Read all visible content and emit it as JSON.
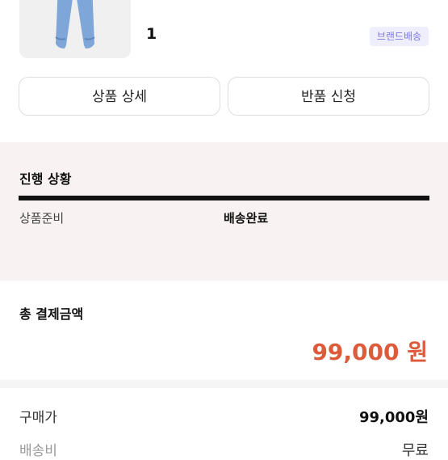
{
  "product": {
    "quantity": "1",
    "badge": "브랜드배송"
  },
  "actions": {
    "detail_label": "상품 상세",
    "return_label": "반품 신청"
  },
  "progress": {
    "title": "진행 상황",
    "steps": [
      "상품준비",
      "배송완료"
    ],
    "current": "배송완료"
  },
  "payment": {
    "title": "총 결제금액",
    "total": "99,000 원",
    "total_color": "#dd5a3b",
    "rows": [
      {
        "label": "구매가",
        "value": "99,000원"
      },
      {
        "label": "배송비",
        "value": "무료"
      }
    ]
  }
}
